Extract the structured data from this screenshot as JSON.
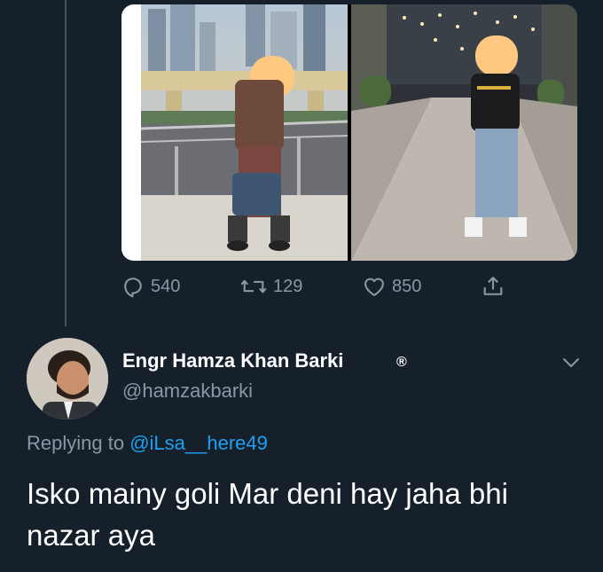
{
  "tweet_actions": {
    "replies": "540",
    "retweets": "129",
    "likes": "850"
  },
  "reply_tweet": {
    "display_name": "Engr Hamza Khan Barki",
    "badge": "®",
    "handle": "@hamzakbarki",
    "replying_prefix": "Replying to",
    "replying_to": "@iLsa__here49",
    "text": "Isko mainy goli Mar deni hay jaha bhi nazar aya"
  },
  "icons": {
    "reply": "reply-icon",
    "retweet": "retweet-icon",
    "like": "heart-icon",
    "share": "share-icon",
    "more": "chevron-down-icon"
  },
  "colors": {
    "background": "#15202b",
    "secondary_text": "#8899a6",
    "link": "#1da1f2",
    "thread_line": "#3d5466"
  }
}
